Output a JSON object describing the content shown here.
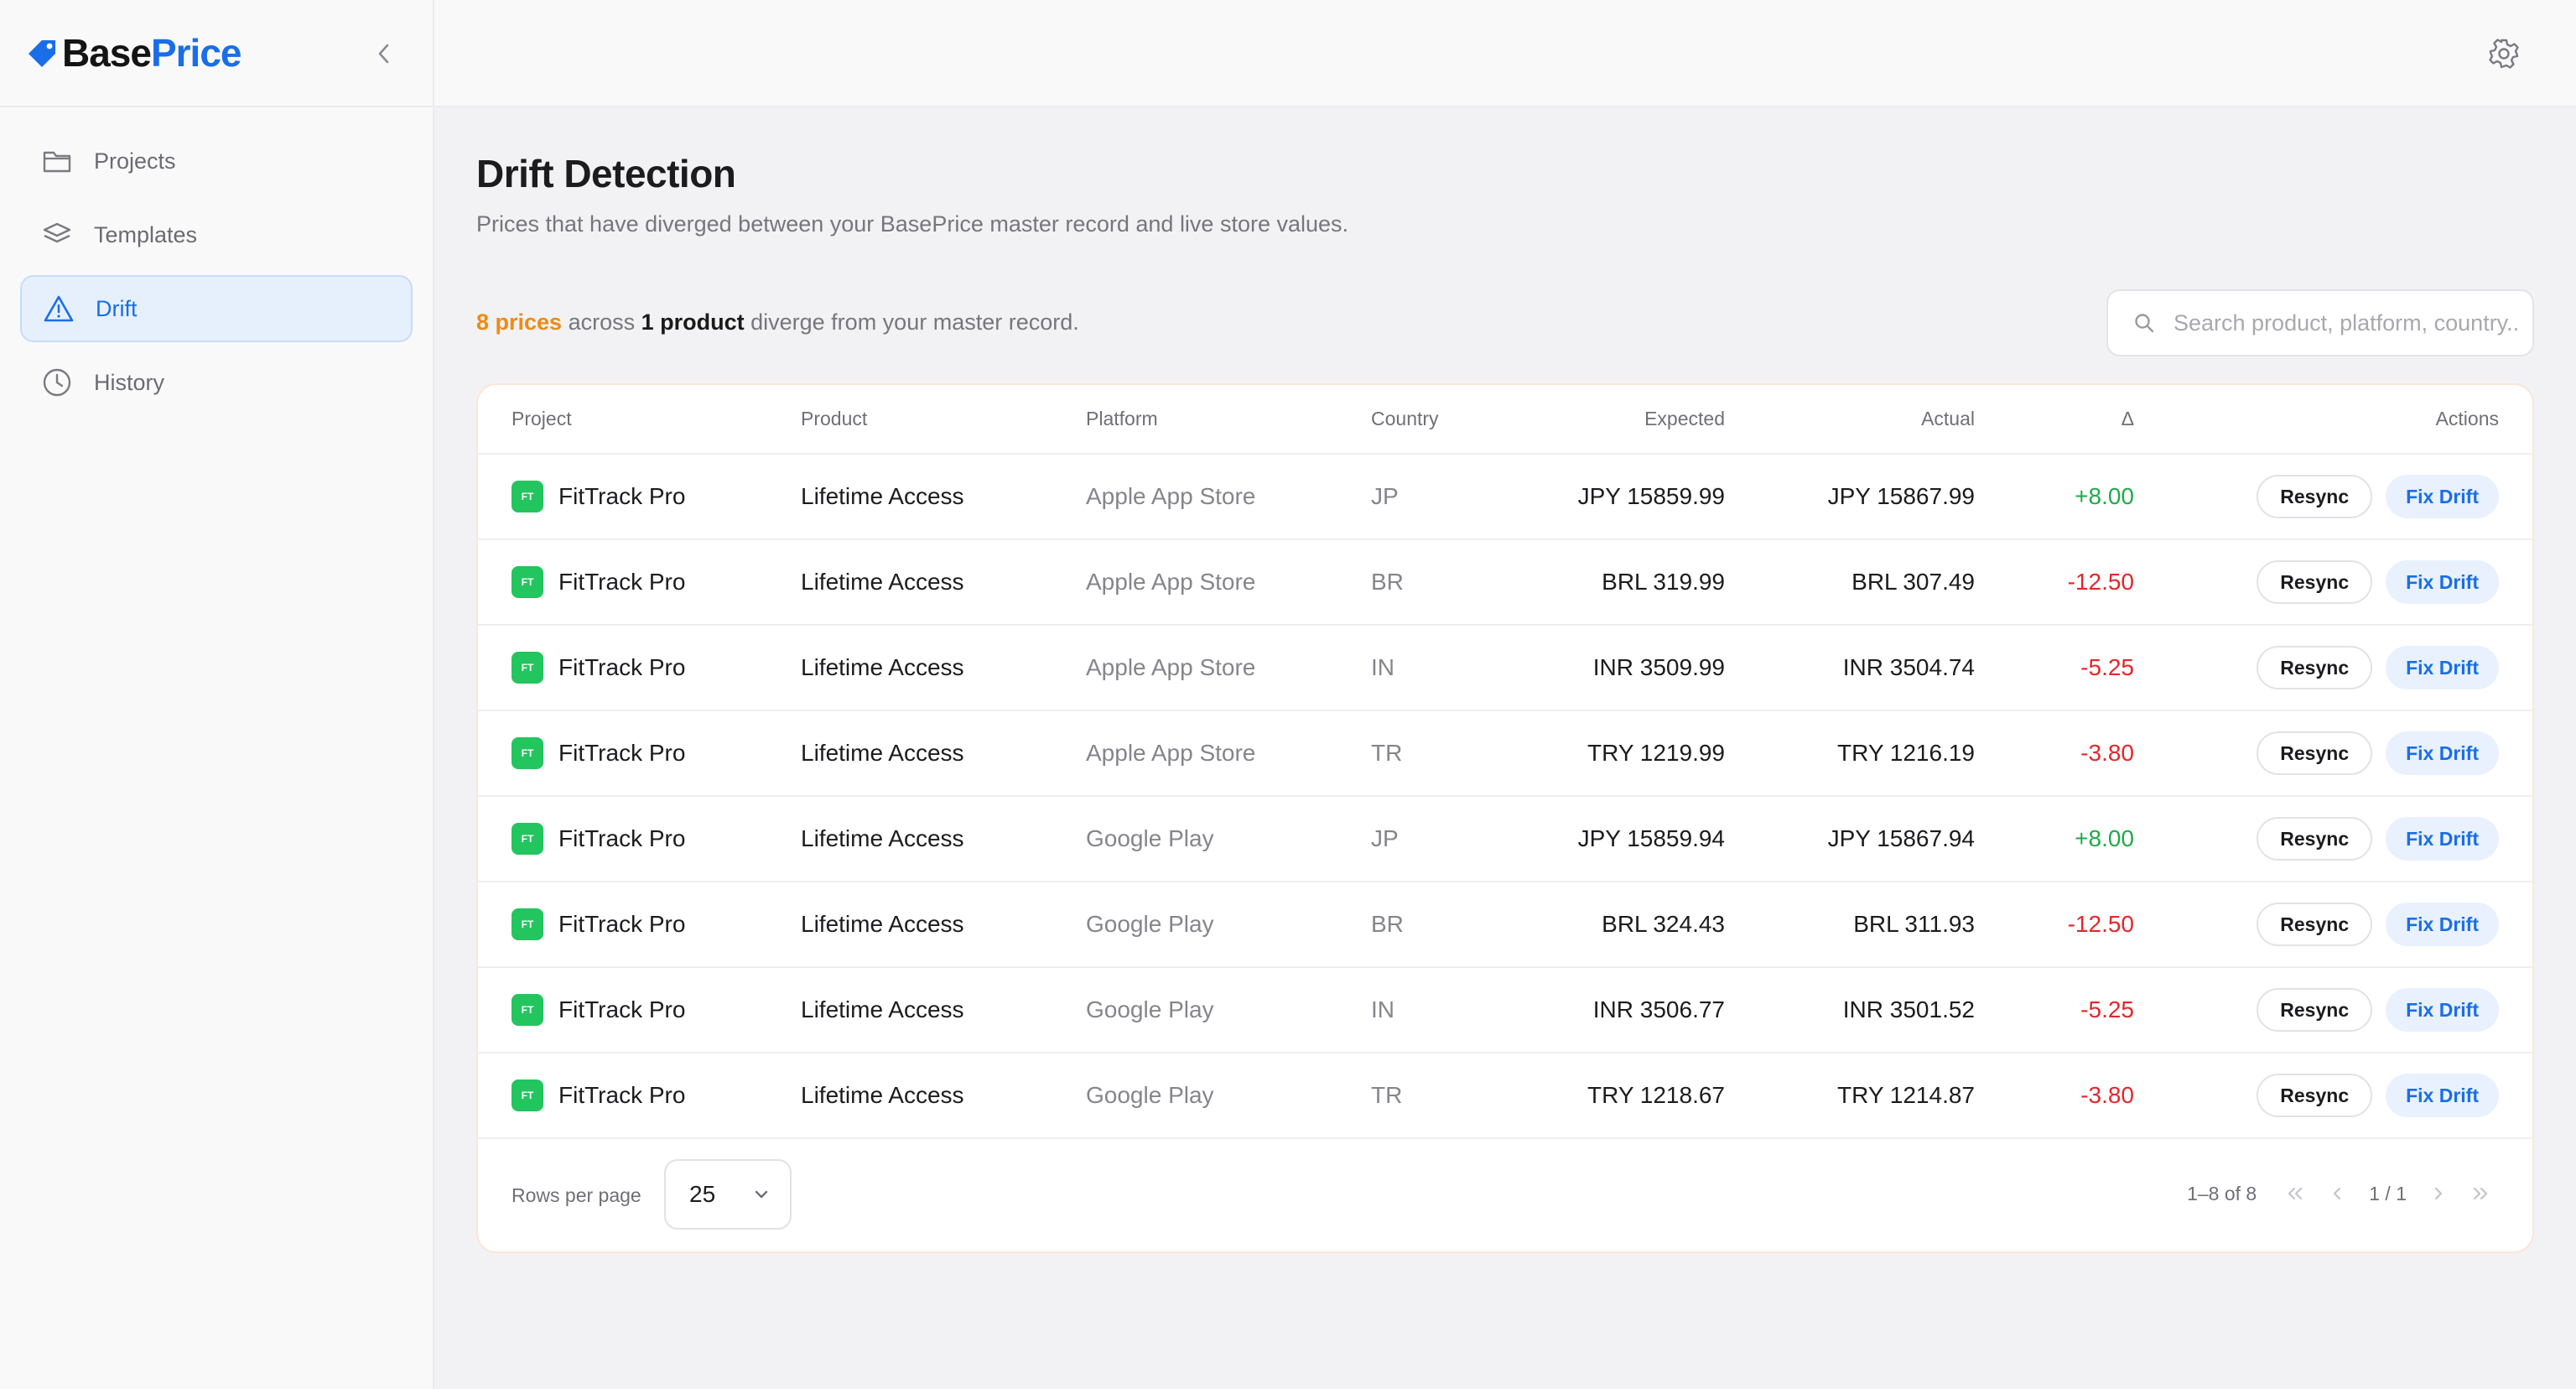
{
  "brand": {
    "name_part1": "Base",
    "name_part2": "Price"
  },
  "sidebar": {
    "items": [
      {
        "label": "Projects",
        "icon": "folder-icon"
      },
      {
        "label": "Templates",
        "icon": "layers-icon"
      },
      {
        "label": "Drift",
        "icon": "warning-triangle-icon",
        "active": true
      },
      {
        "label": "History",
        "icon": "clock-icon"
      }
    ]
  },
  "page": {
    "title": "Drift Detection",
    "subtitle": "Prices that have diverged between your BasePrice master record and live store values."
  },
  "summary": {
    "count": "8 prices",
    "mid1": " across ",
    "product_count": "1 product",
    "tail": " diverge from your master record."
  },
  "search": {
    "placeholder": "Search product, platform, country..."
  },
  "table": {
    "headers": {
      "project": "Project",
      "product": "Product",
      "platform": "Platform",
      "country": "Country",
      "expected": "Expected",
      "actual": "Actual",
      "delta": "Δ",
      "actions": "Actions"
    },
    "rows": [
      {
        "badge": "FT",
        "project": "FitTrack Pro",
        "product": "Lifetime Access",
        "platform": "Apple App Store",
        "country": "JP",
        "expected": "JPY 15859.99",
        "actual": "JPY 15867.99",
        "delta": "+8.00",
        "sign": "pos",
        "resync": "Resync",
        "fix": "Fix Drift"
      },
      {
        "badge": "FT",
        "project": "FitTrack Pro",
        "product": "Lifetime Access",
        "platform": "Apple App Store",
        "country": "BR",
        "expected": "BRL 319.99",
        "actual": "BRL 307.49",
        "delta": "-12.50",
        "sign": "neg",
        "resync": "Resync",
        "fix": "Fix Drift"
      },
      {
        "badge": "FT",
        "project": "FitTrack Pro",
        "product": "Lifetime Access",
        "platform": "Apple App Store",
        "country": "IN",
        "expected": "INR 3509.99",
        "actual": "INR 3504.74",
        "delta": "-5.25",
        "sign": "neg",
        "resync": "Resync",
        "fix": "Fix Drift"
      },
      {
        "badge": "FT",
        "project": "FitTrack Pro",
        "product": "Lifetime Access",
        "platform": "Apple App Store",
        "country": "TR",
        "expected": "TRY 1219.99",
        "actual": "TRY 1216.19",
        "delta": "-3.80",
        "sign": "neg",
        "resync": "Resync",
        "fix": "Fix Drift"
      },
      {
        "badge": "FT",
        "project": "FitTrack Pro",
        "product": "Lifetime Access",
        "platform": "Google Play",
        "country": "JP",
        "expected": "JPY 15859.94",
        "actual": "JPY 15867.94",
        "delta": "+8.00",
        "sign": "pos",
        "resync": "Resync",
        "fix": "Fix Drift"
      },
      {
        "badge": "FT",
        "project": "FitTrack Pro",
        "product": "Lifetime Access",
        "platform": "Google Play",
        "country": "BR",
        "expected": "BRL 324.43",
        "actual": "BRL 311.93",
        "delta": "-12.50",
        "sign": "neg",
        "resync": "Resync",
        "fix": "Fix Drift"
      },
      {
        "badge": "FT",
        "project": "FitTrack Pro",
        "product": "Lifetime Access",
        "platform": "Google Play",
        "country": "IN",
        "expected": "INR 3506.77",
        "actual": "INR 3501.52",
        "delta": "-5.25",
        "sign": "neg",
        "resync": "Resync",
        "fix": "Fix Drift"
      },
      {
        "badge": "FT",
        "project": "FitTrack Pro",
        "product": "Lifetime Access",
        "platform": "Google Play",
        "country": "TR",
        "expected": "TRY 1218.67",
        "actual": "TRY 1214.87",
        "delta": "-3.80",
        "sign": "neg",
        "resync": "Resync",
        "fix": "Fix Drift"
      }
    ]
  },
  "footer": {
    "rows_per_page_label": "Rows per page",
    "rows_per_page_value": "25",
    "range": "1–8 of 8",
    "page_indicator": "1 / 1"
  },
  "colors": {
    "accent": "#1a6ee8",
    "warning": "#f08a12",
    "positive": "#1faa4a",
    "negative": "#e5262b",
    "badge": "#22c55e"
  }
}
